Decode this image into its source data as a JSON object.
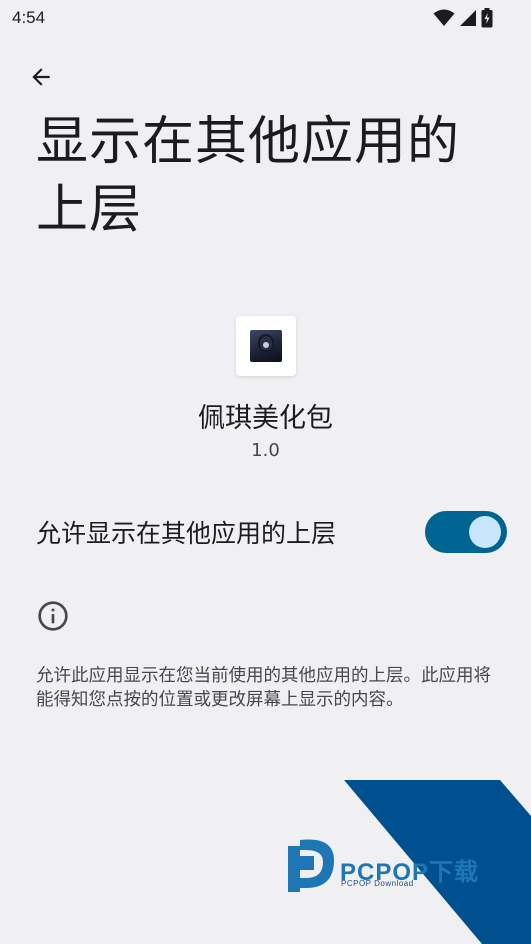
{
  "status_bar": {
    "time": "4:54",
    "icons": [
      "wifi-icon",
      "cellular-signal-icon",
      "battery-charging-icon"
    ]
  },
  "nav": {
    "back_icon": "arrow-left-icon"
  },
  "page": {
    "title": "显示在其他应用的上层"
  },
  "app": {
    "icon": "app-thumbnail-icon",
    "name": "佩琪美化包",
    "version": "1.0"
  },
  "permission": {
    "label": "允许显示在其他应用的上层",
    "enabled": true
  },
  "info": {
    "icon": "info-icon",
    "description": "允许此应用显示在您当前使用的其他应用的上层。此应用将能得知您点按的位置或更改屏幕上显示的内容。"
  },
  "watermark": {
    "brand": "PCPOP下载",
    "tagline": "PCPOP Download"
  },
  "colors": {
    "background": "#f0f0f3",
    "switch_track": "#006493",
    "switch_thumb": "#c9e6ff",
    "watermark_blue": "#00508f"
  }
}
